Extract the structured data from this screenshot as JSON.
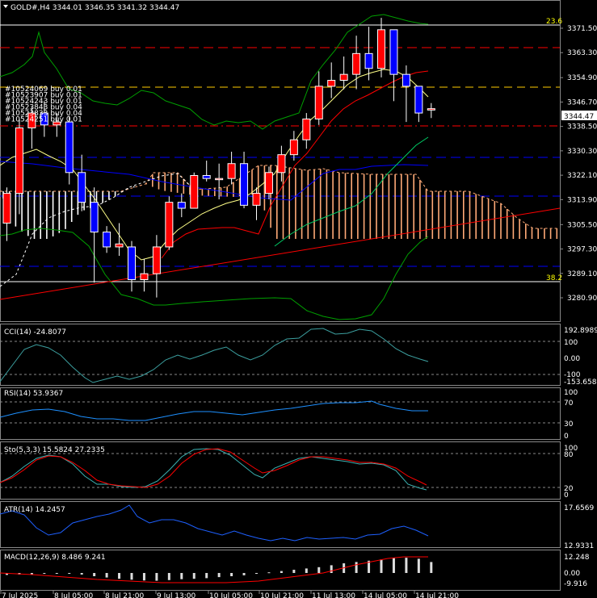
{
  "header": {
    "symbol_line": "GOLD#,H4  3344.01 3346.35 3341.32 3344.47"
  },
  "colors": {
    "background": "#000000",
    "bull_candle": "#ff0000",
    "bear_candle": "#0000ff",
    "bb_line": "#00aa00",
    "fib_line": "#ffff00",
    "red_dash": "#ff0000",
    "blue_dash": "#0000ff",
    "cloud": "#ffaa77",
    "cloud_b": "#ffffff",
    "trendline": "#ff0000",
    "cci": "#3ca0a0",
    "rsi": "#1e90ff",
    "stoch_main": "#3cb3b3",
    "stoch_signal": "#ff0000",
    "atr": "#1e60ff",
    "macd_hist": "#dddddd",
    "macd_signal": "#ff0000"
  },
  "price_axis": {
    "ticks": [
      "3371.50",
      "3363.30",
      "3354.90",
      "3346.70",
      "3338.50",
      "3330.30",
      "3322.10",
      "3313.90",
      "3305.50",
      "3297.30",
      "3289.10",
      "3280.90"
    ],
    "current": "3344.47"
  },
  "levels": {
    "fib_top": "23.6",
    "fib_bottom": "38.2"
  },
  "trade_labels": [
    "#10524069 buy 0.01",
    "#10523907 buy 0.01",
    "#10524243 buy 0.01",
    "#10523843 buy 0.04",
    "#10523833 buy 0.04",
    "#10524251 buy 0.01"
  ],
  "time_axis": [
    "7 Jul 2025",
    "8 Jul 05:00",
    "8 Jul 21:00",
    "9 Jul 13:00",
    "10 Jul 05:00",
    "10 Jul 21:00",
    "11 Jul 13:00",
    "14 Jul 05:00",
    "14 Jul 21:00"
  ],
  "indicators": {
    "cci": {
      "label": "CCI(14) -24.8077",
      "ticks": [
        "192.8989",
        "100",
        "0.00",
        "-100",
        "-153.6588"
      ]
    },
    "rsi": {
      "label": "RSI(14) 53.9367",
      "ticks": [
        "100",
        "70",
        "30",
        "0"
      ]
    },
    "stoch": {
      "label": "Sto(5,3,3) 15.5824 27.2335",
      "ticks": [
        "100",
        "80",
        "20",
        "0"
      ]
    },
    "atr": {
      "label": "ATR(14) 14.2457",
      "ticks": [
        "17.6569",
        "12.9331"
      ]
    },
    "macd": {
      "label": "MACD(12,26,9) 8.486 9.241",
      "ticks": [
        "12.248",
        "0.00",
        "-9.916"
      ]
    }
  },
  "chart_data": {
    "type": "candlestick",
    "symbol": "GOLD#",
    "timeframe": "H4",
    "candles": [
      {
        "o": 3306,
        "h": 3318,
        "l": 3300,
        "c": 3316
      },
      {
        "o": 3316,
        "h": 3341,
        "l": 3309,
        "c": 3338
      },
      {
        "o": 3338,
        "h": 3345,
        "l": 3331,
        "c": 3343
      },
      {
        "o": 3343,
        "h": 3347,
        "l": 3335,
        "c": 3339
      },
      {
        "o": 3339,
        "h": 3343,
        "l": 3335,
        "c": 3340
      },
      {
        "o": 3340,
        "h": 3342,
        "l": 3319,
        "c": 3323
      },
      {
        "o": 3323,
        "h": 3329,
        "l": 3310,
        "c": 3313
      },
      {
        "o": 3313,
        "h": 3318,
        "l": 3286,
        "c": 3303
      },
      {
        "o": 3303,
        "h": 3305,
        "l": 3296,
        "c": 3298
      },
      {
        "o": 3298,
        "h": 3306,
        "l": 3295,
        "c": 3299
      },
      {
        "o": 3298,
        "h": 3300,
        "l": 3283,
        "c": 3287
      },
      {
        "o": 3287,
        "h": 3294,
        "l": 3283,
        "c": 3289
      },
      {
        "o": 3289,
        "h": 3302,
        "l": 3281,
        "c": 3298
      },
      {
        "o": 3298,
        "h": 3315,
        "l": 3297,
        "c": 3313
      },
      {
        "o": 3313,
        "h": 3316,
        "l": 3308,
        "c": 3311
      },
      {
        "o": 3311,
        "h": 3323,
        "l": 3311,
        "c": 3322
      },
      {
        "o": 3322,
        "h": 3327,
        "l": 3320,
        "c": 3321
      },
      {
        "o": 3321,
        "h": 3326,
        "l": 3314,
        "c": 3321
      },
      {
        "o": 3321,
        "h": 3330,
        "l": 3319,
        "c": 3326
      },
      {
        "o": 3326,
        "h": 3330,
        "l": 3311,
        "c": 3312
      },
      {
        "o": 3312,
        "h": 3318,
        "l": 3307,
        "c": 3316
      },
      {
        "o": 3316,
        "h": 3325,
        "l": 3314,
        "c": 3323
      },
      {
        "o": 3323,
        "h": 3332,
        "l": 3320,
        "c": 3329
      },
      {
        "o": 3329,
        "h": 3337,
        "l": 3327,
        "c": 3334
      },
      {
        "o": 3334,
        "h": 3343,
        "l": 3331,
        "c": 3341
      },
      {
        "o": 3341,
        "h": 3357,
        "l": 3339,
        "c": 3352
      },
      {
        "o": 3352,
        "h": 3360,
        "l": 3348,
        "c": 3354
      },
      {
        "o": 3354,
        "h": 3362,
        "l": 3351,
        "c": 3356
      },
      {
        "o": 3356,
        "h": 3369,
        "l": 3351,
        "c": 3363
      },
      {
        "o": 3363,
        "h": 3372,
        "l": 3354,
        "c": 3358
      },
      {
        "o": 3358,
        "h": 3375,
        "l": 3355,
        "c": 3371
      },
      {
        "o": 3371,
        "h": 3371,
        "l": 3347,
        "c": 3356
      },
      {
        "o": 3356,
        "h": 3359,
        "l": 3340,
        "c": 3352
      },
      {
        "o": 3352,
        "h": 3352,
        "l": 3340,
        "c": 3343
      },
      {
        "o": 3344.01,
        "h": 3346.35,
        "l": 3341.32,
        "c": 3344.47
      }
    ],
    "indicators": [
      "CCI(14)",
      "RSI(14)",
      "Sto(5,3,3)",
      "ATR(14)",
      "MACD(12,26,9)"
    ]
  }
}
